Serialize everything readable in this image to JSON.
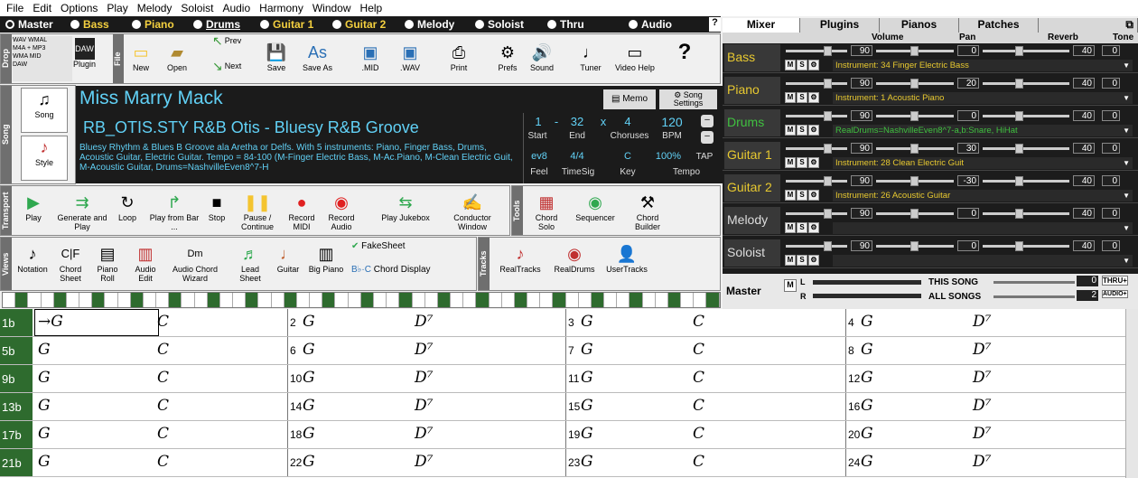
{
  "menu": [
    "File",
    "Edit",
    "Options",
    "Play",
    "Melody",
    "Soloist",
    "Audio",
    "Harmony",
    "Window",
    "Help"
  ],
  "tracks": [
    {
      "name": "Master",
      "style": "white"
    },
    {
      "name": "Bass",
      "style": "yellow"
    },
    {
      "name": "Piano",
      "style": "yellow"
    },
    {
      "name": "Drums",
      "style": "yellow-underlined"
    },
    {
      "name": "Guitar 1",
      "style": "yellow"
    },
    {
      "name": "Guitar 2",
      "style": "yellow"
    },
    {
      "name": "Melody",
      "style": "white"
    },
    {
      "name": "Soloist",
      "style": "white"
    },
    {
      "name": "Thru",
      "style": "white"
    },
    {
      "name": "Audio",
      "style": "white"
    }
  ],
  "help_q": "?",
  "file_toolbar": {
    "plugin": "Plugin",
    "new": "New",
    "open": "Open",
    "prev": "Prev",
    "next": "Next",
    "save": "Save",
    "saveas": "Save As",
    "mid": ".MID",
    "wav": ".WAV",
    "print": "Print",
    "prefs": "Prefs",
    "sound": "Sound",
    "tuner": "Tuner",
    "videohelp": "Video Help",
    "formats": [
      "WAV",
      "WMAL",
      "M4A",
      "MP3",
      "WMA",
      "MID",
      "DAW"
    ]
  },
  "song": {
    "title": "Miss Marry Mack",
    "memo": "Memo",
    "song_settings": "Song Settings",
    "song_btn": "Song",
    "style_btn": "Style",
    "style_title": "RB_OTIS.STY R&B Otis - Bluesy R&B Groove",
    "style_desc": "Bluesy Rhythm & Blues B Groove ala Aretha or Delfs. With 5 instruments: Piano, Finger Bass, Drums, Acoustic Guitar, Electric Guitar. Tempo = 84-100    (M-Finger Electric Bass, M-Ac.Piano, M-Clean Electric Guit, M-Acoustic Guitar, Drums=NashvilleEven8^7-H",
    "start": "1",
    "end": "32",
    "x": "x",
    "choruses": "4",
    "bpm": "120",
    "start_lbl": "Start",
    "end_lbl": "End",
    "choruses_lbl": "Choruses",
    "bpm_lbl": "BPM",
    "feel": "ev8",
    "timesig": "4/4",
    "key": "C",
    "tempo_pct": "100%",
    "tap": "TAP",
    "feel_lbl": "Feel",
    "timesig_lbl": "TimeSig",
    "key_lbl": "Key",
    "tempo_lbl": "Tempo",
    "dash": "-"
  },
  "side_labels": {
    "drop": "Drop",
    "file": "File",
    "song": "Song",
    "transport": "Transport",
    "tools": "Tools",
    "views": "Views",
    "tracks": "Tracks"
  },
  "transport": {
    "play": "Play",
    "generate": "Generate and Play",
    "loop": "Loop",
    "playfrom": "Play from Bar ...",
    "stop": "Stop",
    "pause": "Pause / Continue",
    "recmidi": "Record MIDI",
    "recaudio": "Record Audio",
    "jukebox": "Play Jukebox",
    "conductor": "Conductor Window"
  },
  "tools": {
    "chordsolo": "Chord Solo",
    "sequencer": "Sequencer",
    "chordbuilder": "Chord Builder"
  },
  "views": {
    "notation": "Notation",
    "chordsheet": "Chord Sheet",
    "pianoroll": "Piano Roll",
    "audioedit": "Audio Edit",
    "wizard": "Audio Chord Wizard",
    "leadsheet": "Lead Sheet",
    "guitar": "Guitar",
    "bigpiano": "Big Piano",
    "fakesheet": "FakeSheet",
    "chorddisplay": "Chord Display"
  },
  "trackstb": {
    "realtracks": "RealTracks",
    "realdrums": "RealDrums",
    "usertracks": "UserTracks"
  },
  "mixer": {
    "tabs": [
      "Mixer",
      "Plugins",
      "Pianos",
      "Patches"
    ],
    "cols": {
      "volume": "Volume",
      "pan": "Pan",
      "reverb": "Reverb",
      "tone": "Tone"
    },
    "rows": [
      {
        "name": "Bass",
        "color": "yellow",
        "vol": "90",
        "pan": "0",
        "rev": "40",
        "tone": "0",
        "inst": "Instrument: 34 Finger Electric Bass",
        "instcolor": "yellow"
      },
      {
        "name": "Piano",
        "color": "yellow",
        "vol": "90",
        "pan": "20",
        "rev": "40",
        "tone": "0",
        "inst": "Instrument: 1 Acoustic Piano",
        "instcolor": "yellow"
      },
      {
        "name": "Drums",
        "color": "green",
        "vol": "90",
        "pan": "0",
        "rev": "40",
        "tone": "0",
        "inst": "RealDrums=NashvilleEven8^7-a,b:Snare, HiHat",
        "instcolor": "green"
      },
      {
        "name": "Guitar 1",
        "color": "yellow",
        "vol": "90",
        "pan": "30",
        "rev": "40",
        "tone": "0",
        "inst": "Instrument: 28 Clean Electric Guit",
        "instcolor": "yellow"
      },
      {
        "name": "Guitar 2",
        "color": "yellow",
        "vol": "90",
        "pan": "-30",
        "rev": "40",
        "tone": "0",
        "inst": "Instrument: 26 Acoustic Guitar",
        "instcolor": "yellow"
      },
      {
        "name": "Melody",
        "color": "white",
        "vol": "90",
        "pan": "0",
        "rev": "40",
        "tone": "0",
        "inst": "",
        "instcolor": "yellow"
      },
      {
        "name": "Soloist",
        "color": "white",
        "vol": "90",
        "pan": "0",
        "rev": "40",
        "tone": "0",
        "inst": "",
        "instcolor": "yellow"
      }
    ],
    "master": "Master",
    "m": "M",
    "l": "L",
    "r": "R",
    "thissong": "THIS SONG",
    "allsongs": "ALL SONGS",
    "thisval": "0",
    "allval": "2",
    "thru": "THRU+",
    "audio": "AUDIO+"
  },
  "chord_rows": [
    {
      "label": "1b",
      "bars": [
        {
          "n": "",
          "c1": "→G",
          "c2": "C"
        },
        {
          "n": "2",
          "c1": "G",
          "c2": "D⁷"
        },
        {
          "n": "3",
          "c1": "G",
          "c2": "C"
        },
        {
          "n": "4",
          "c1": "G",
          "c2": "D⁷"
        }
      ]
    },
    {
      "label": "5b",
      "bars": [
        {
          "n": "",
          "c1": "G",
          "c2": "C"
        },
        {
          "n": "6",
          "c1": "G",
          "c2": "D⁷"
        },
        {
          "n": "7",
          "c1": "G",
          "c2": "C"
        },
        {
          "n": "8",
          "c1": "G",
          "c2": "D⁷"
        }
      ]
    },
    {
      "label": "9b",
      "bars": [
        {
          "n": "",
          "c1": "G",
          "c2": "C"
        },
        {
          "n": "10",
          "c1": "G",
          "c2": "D⁷"
        },
        {
          "n": "11",
          "c1": "G",
          "c2": "C"
        },
        {
          "n": "12",
          "c1": "G",
          "c2": "D⁷"
        }
      ]
    },
    {
      "label": "13b",
      "bars": [
        {
          "n": "",
          "c1": "G",
          "c2": "C"
        },
        {
          "n": "14",
          "c1": "G",
          "c2": "D⁷"
        },
        {
          "n": "15",
          "c1": "G",
          "c2": "C"
        },
        {
          "n": "16",
          "c1": "G",
          "c2": "D⁷"
        }
      ]
    },
    {
      "label": "17b",
      "bars": [
        {
          "n": "",
          "c1": "G",
          "c2": "C"
        },
        {
          "n": "18",
          "c1": "G",
          "c2": "D⁷"
        },
        {
          "n": "19",
          "c1": "G",
          "c2": "C"
        },
        {
          "n": "20",
          "c1": "G",
          "c2": "D⁷"
        }
      ]
    },
    {
      "label": "21b",
      "bars": [
        {
          "n": "",
          "c1": "G",
          "c2": "C"
        },
        {
          "n": "22",
          "c1": "G",
          "c2": "D⁷"
        },
        {
          "n": "23",
          "c1": "G",
          "c2": "C"
        },
        {
          "n": "24",
          "c1": "G",
          "c2": "D⁷"
        }
      ]
    }
  ]
}
